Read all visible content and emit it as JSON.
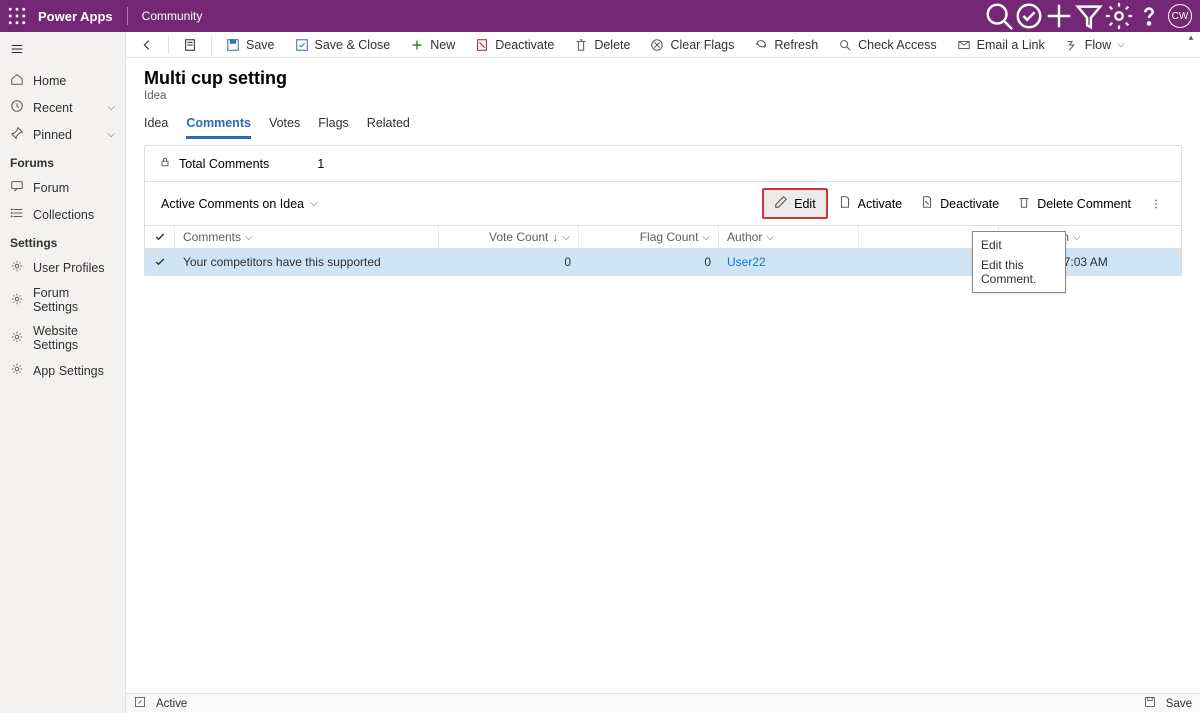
{
  "header": {
    "brand": "Power Apps",
    "env": "Community",
    "avatar": "CW"
  },
  "leftnav": {
    "home": "Home",
    "recent": "Recent",
    "pinned": "Pinned",
    "section_forums": "Forums",
    "forum": "Forum",
    "collections": "Collections",
    "section_settings": "Settings",
    "user_profiles": "User Profiles",
    "forum_settings": "Forum Settings",
    "website_settings": "Website Settings",
    "app_settings": "App Settings"
  },
  "cmdbar": {
    "save": "Save",
    "save_close": "Save & Close",
    "new": "New",
    "deactivate": "Deactivate",
    "delete": "Delete",
    "clear_flags": "Clear Flags",
    "refresh": "Refresh",
    "check_access": "Check Access",
    "email_link": "Email a Link",
    "flow": "Flow"
  },
  "page": {
    "title": "Multi cup setting",
    "subtitle": "Idea"
  },
  "tabs": {
    "idea": "Idea",
    "comments": "Comments",
    "votes": "Votes",
    "flags": "Flags",
    "related": "Related"
  },
  "summary": {
    "label": "Total Comments",
    "count": "1"
  },
  "subgrid": {
    "title": "Active Comments on Idea",
    "edit": "Edit",
    "activate": "Activate",
    "deactivate": "Deactivate",
    "delete_comment": "Delete Comment"
  },
  "columns": {
    "comments": "Comments",
    "vote_count": "Vote Count",
    "flag_count": "Flag Count",
    "author": "Author",
    "created_on": "Created On"
  },
  "row": {
    "comment": "Your competitors have this supported",
    "vote_count": "0",
    "flag_count": "0",
    "author": "User22",
    "created_on": "9/23/2021 7:03 AM"
  },
  "tooltip": {
    "title": "Edit",
    "body": "Edit this Comment."
  },
  "footer": {
    "status": "Active",
    "save": "Save"
  }
}
